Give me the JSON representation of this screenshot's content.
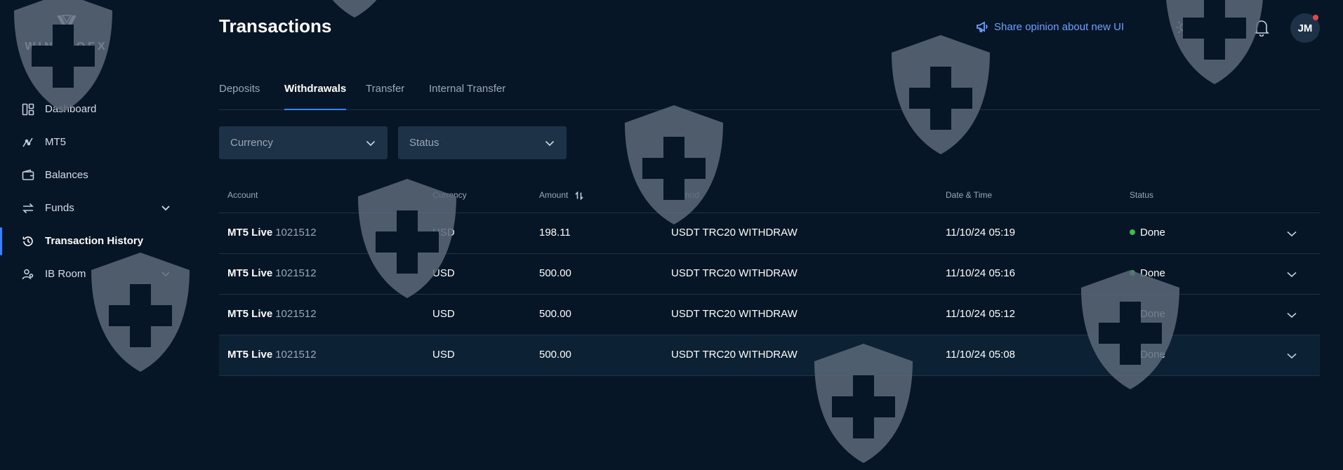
{
  "brand": {
    "name": "WINPROFX"
  },
  "sidebar": {
    "items": [
      {
        "label": "Dashboard",
        "icon": "dashboard-icon"
      },
      {
        "label": "MT5",
        "icon": "mt5-icon"
      },
      {
        "label": "Balances",
        "icon": "wallet-icon"
      },
      {
        "label": "Funds",
        "icon": "transfer-arrows-icon"
      },
      {
        "label": "Transaction History",
        "icon": "history-icon"
      },
      {
        "label": "IB Room",
        "icon": "users-icon"
      }
    ]
  },
  "header": {
    "title": "Transactions",
    "share_label": "Share opinion about new UI",
    "avatar_initials": "JM"
  },
  "tabs": [
    {
      "label": "Deposits"
    },
    {
      "label": "Withdrawals"
    },
    {
      "label": "Transfer"
    },
    {
      "label": "Internal Transfer"
    }
  ],
  "filters": {
    "currency_placeholder": "Currency",
    "status_placeholder": "Status"
  },
  "table": {
    "columns": [
      "Account",
      "Currency",
      "Amount",
      "Method",
      "Date & Time",
      "Status"
    ],
    "rows": [
      {
        "account_type": "MT5 Live",
        "account_number": "1021512",
        "currency": "USD",
        "amount": "198.11",
        "method": "USDT TRC20 WITHDRAW",
        "datetime": "11/10/24 05:19",
        "status": "Done"
      },
      {
        "account_type": "MT5 Live",
        "account_number": "1021512",
        "currency": "USD",
        "amount": "500.00",
        "method": "USDT TRC20 WITHDRAW",
        "datetime": "11/10/24 05:16",
        "status": "Done"
      },
      {
        "account_type": "MT5 Live",
        "account_number": "1021512",
        "currency": "USD",
        "amount": "500.00",
        "method": "USDT TRC20 WITHDRAW",
        "datetime": "11/10/24 05:12",
        "status": "Done"
      },
      {
        "account_type": "MT5 Live",
        "account_number": "1021512",
        "currency": "USD",
        "amount": "500.00",
        "method": "USDT TRC20 WITHDRAW",
        "datetime": "11/10/24 05:08",
        "status": "Done"
      }
    ]
  },
  "colors": {
    "background": "#071626",
    "accent": "#3d82f5",
    "link": "#6aa0ff",
    "status_done": "#3fb950",
    "notification": "#e04a4a"
  }
}
